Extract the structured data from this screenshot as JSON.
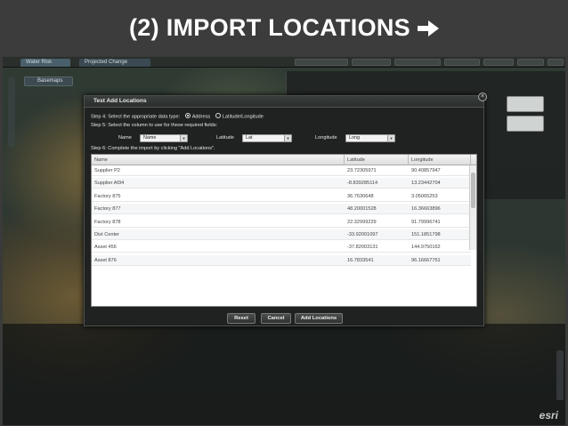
{
  "banner": {
    "title": "(2) IMPORT LOCATIONS",
    "arrow_icon": "right-arrow-icon"
  },
  "app": {
    "tabs": [
      "Water Risk",
      "Projected Change"
    ],
    "basemaps_label": "Basemaps"
  },
  "dialog": {
    "title": "Test Add Locations",
    "step4": "Step 4: Select the appropriate data type:",
    "radio_address": "Address",
    "radio_latlong": "Latitude/Longitude",
    "step5": "Step 5: Select the column to use for these required fields:",
    "name_label": "Name",
    "name_value": "Name",
    "latitude_label": "Latitude",
    "latitude_value": "Lat",
    "longitude_label": "Longitude",
    "longitude_value": "Long",
    "step6": "Step 6: Complete the import by clicking \"Add Locations\".",
    "table": {
      "headers": [
        "Name",
        "Latitude",
        "Longitude"
      ],
      "rows": [
        [
          "Supplier P2",
          "23.72305971",
          "90.40857947"
        ],
        [
          "Supplier Af34",
          "-8.839285114",
          "13.23442704"
        ],
        [
          "Factory 875",
          "36.7630648",
          "3.05065253"
        ],
        [
          "Factory 877",
          "48.20001528",
          "16.36663896"
        ],
        [
          "Factory 878",
          "22.32999229",
          "91.79996741"
        ],
        [
          "Dist Center",
          "-33.92001097",
          "151.1851798"
        ],
        [
          "Asset 456",
          "-37.82003131",
          "144.9750162"
        ],
        [
          "Asset 876",
          "16.7833541",
          "96.16667761"
        ]
      ]
    },
    "buttons": {
      "reset": "Reset",
      "cancel": "Cancel",
      "add": "Add Locations"
    }
  },
  "colors": {
    "banner_bg": "#3c3c3c",
    "banner_text": "#ffffff",
    "dialog_bg": "#1f2221"
  }
}
